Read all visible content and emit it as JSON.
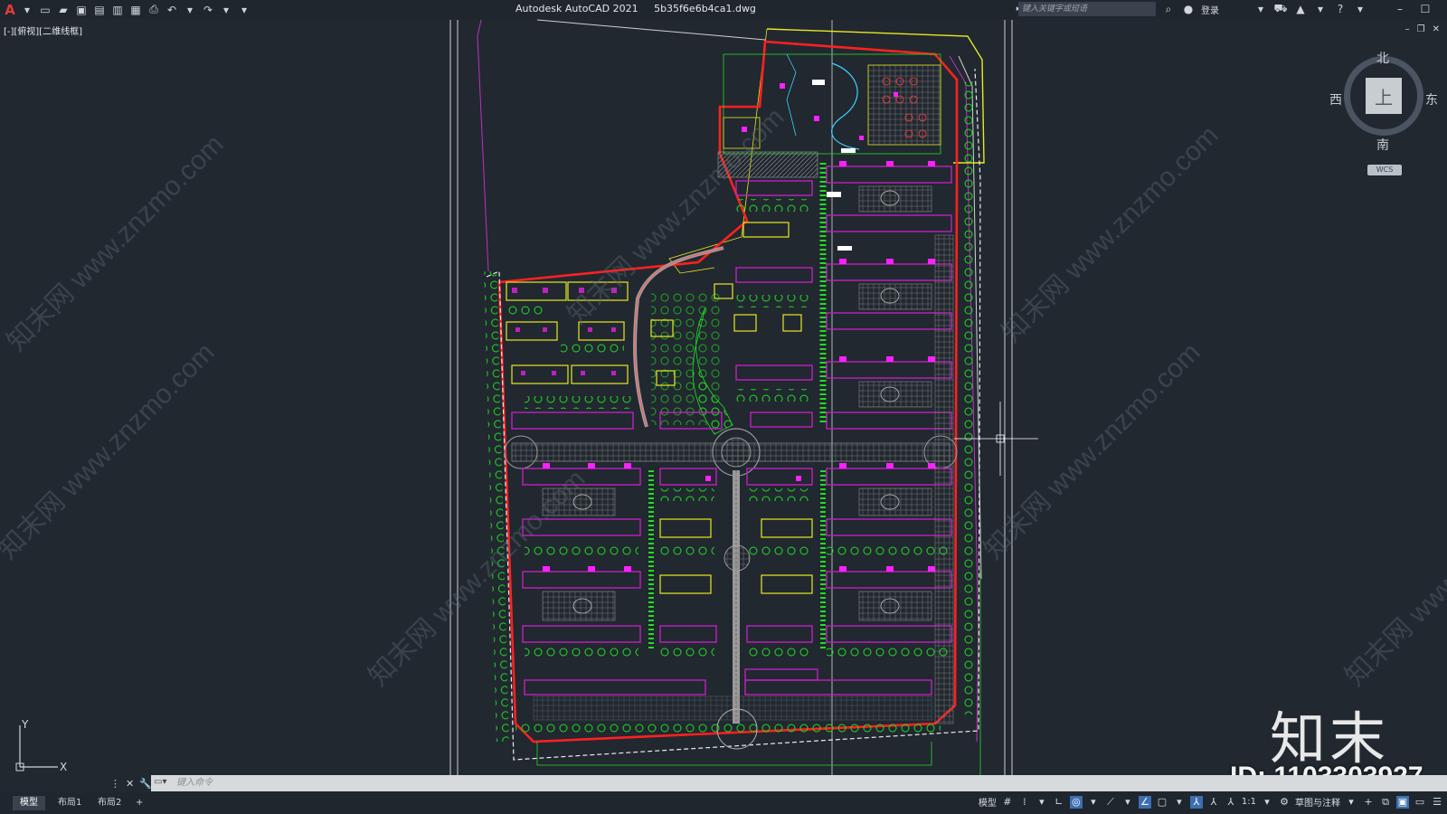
{
  "app": {
    "title": "Autodesk AutoCAD 2021",
    "filename": "5b35f6e6b4ca1.dwg",
    "logo_letter": "A"
  },
  "quick_access": {
    "icons": [
      "new-icon",
      "open-icon",
      "save-icon",
      "save-as-icon",
      "publish-icon",
      "plot-preview-icon",
      "print-icon",
      "undo-icon",
      "redo-icon",
      "customize-icon"
    ]
  },
  "search": {
    "placeholder": "键入关键字或短语"
  },
  "account": {
    "login_label": "登录"
  },
  "viewport": {
    "label": "[-][俯视][二维线框]"
  },
  "viewcube": {
    "north": "北",
    "south": "南",
    "east": "东",
    "west": "西",
    "face": "上",
    "wcs": "WCS"
  },
  "ucs": {
    "x": "X",
    "y": "Y"
  },
  "command": {
    "placeholder": "键入命令"
  },
  "layout_tabs": [
    {
      "label": "模型",
      "active": true
    },
    {
      "label": "布局1",
      "active": false
    },
    {
      "label": "布局2",
      "active": false
    }
  ],
  "add_tab_label": "+",
  "status": {
    "model_label": "模型",
    "scale_label": "1:1",
    "workspace_label": "草图与注释"
  },
  "watermark": {
    "brand": "知末",
    "id_text": "ID: 1103303927",
    "diagonal_text": "知末网 www.znzmo.com"
  },
  "colors": {
    "background": "#212830",
    "boundary": "#ff2020",
    "building": "#c020c0",
    "tree": "#22dd22",
    "villa": "#e8e820"
  }
}
